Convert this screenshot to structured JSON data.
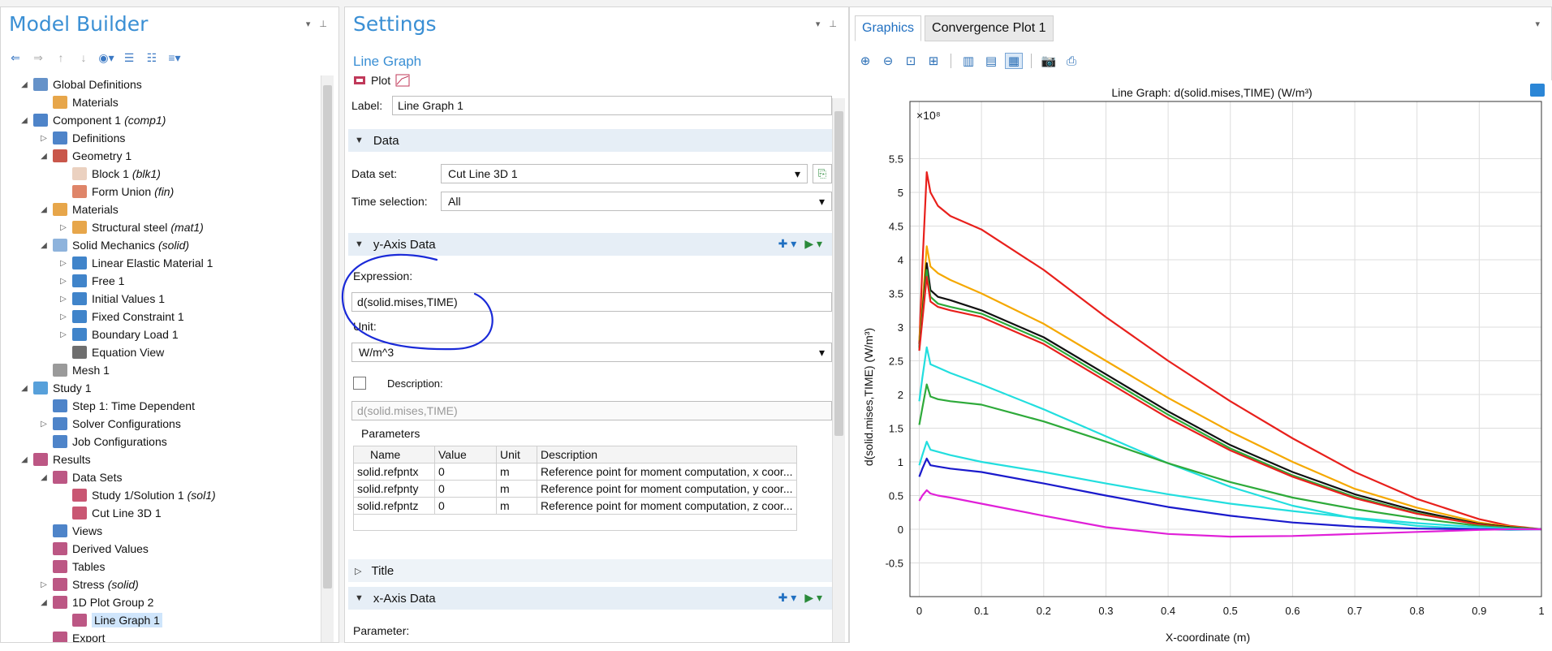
{
  "model_builder": {
    "title": "Model Builder",
    "tree": [
      {
        "label": "Global Definitions",
        "level": 1,
        "icon": "globe-icon",
        "expanded": true,
        "color": "#4a7fc0"
      },
      {
        "label": "Materials",
        "level": 2,
        "icon": "materials-icon",
        "color": "#e3962a"
      },
      {
        "label": "Component 1",
        "suffix": "(comp1)",
        "level": 1,
        "icon": "component-icon",
        "expanded": true,
        "color": "#2f6fbf"
      },
      {
        "label": "Definitions",
        "level": 2,
        "icon": "definitions-icon",
        "collapsed": true,
        "color": "#2f6fbf"
      },
      {
        "label": "Geometry 1",
        "level": 2,
        "icon": "geometry-icon",
        "expanded": true,
        "color": "#c0392b"
      },
      {
        "label": "Block 1",
        "suffix": "(blk1)",
        "level": 3,
        "icon": "block-icon",
        "color": "#e8c9b5"
      },
      {
        "label": "Form Union",
        "suffix": "(fin)",
        "level": 3,
        "icon": "form-union-icon",
        "color": "#d9704f"
      },
      {
        "label": "Materials",
        "level": 2,
        "icon": "materials-icon",
        "expanded": true,
        "color": "#e3962a"
      },
      {
        "label": "Structural steel",
        "suffix": "(mat1)",
        "level": 3,
        "icon": "material-icon",
        "collapsed": true,
        "color": "#e3962a"
      },
      {
        "label": "Solid Mechanics",
        "suffix": "(solid)",
        "level": 2,
        "icon": "solid-mechanics-icon",
        "expanded": true,
        "color": "#7aa6d6"
      },
      {
        "label": "Linear Elastic Material 1",
        "level": 3,
        "icon": "domain-icon",
        "collapsed": true,
        "color": "#1f6fc1"
      },
      {
        "label": "Free 1",
        "level": 3,
        "icon": "domain-icon",
        "collapsed": true,
        "color": "#1f6fc1"
      },
      {
        "label": "Initial Values 1",
        "level": 3,
        "icon": "domain-icon",
        "collapsed": true,
        "color": "#1f6fc1"
      },
      {
        "label": "Fixed Constraint 1",
        "level": 3,
        "icon": "boundary-icon",
        "collapsed": true,
        "color": "#1f6fc1"
      },
      {
        "label": "Boundary Load 1",
        "level": 3,
        "icon": "boundary-icon",
        "collapsed": true,
        "color": "#1f6fc1"
      },
      {
        "label": "Equation View",
        "level": 3,
        "icon": "equation-view-icon",
        "color": "#555555"
      },
      {
        "label": "Mesh 1",
        "level": 2,
        "icon": "mesh-icon",
        "color": "#888888"
      },
      {
        "label": "Study 1",
        "level": 1,
        "icon": "study-icon",
        "expanded": true,
        "color": "#3a8fd4"
      },
      {
        "label": "Step 1: Time Dependent",
        "level": 2,
        "icon": "time-dependent-icon",
        "color": "#2f6fbf"
      },
      {
        "label": "Solver Configurations",
        "level": 2,
        "icon": "solver-icon",
        "collapsed": true,
        "color": "#2f6fbf"
      },
      {
        "label": "Job Configurations",
        "level": 2,
        "icon": "job-icon",
        "color": "#2f6fbf"
      },
      {
        "label": "Results",
        "level": 1,
        "icon": "results-icon",
        "expanded": true,
        "color": "#b03a6f"
      },
      {
        "label": "Data Sets",
        "level": 2,
        "icon": "data-sets-icon",
        "expanded": true,
        "color": "#b03a6f"
      },
      {
        "label": "Study 1/Solution 1",
        "suffix": "(sol1)",
        "level": 3,
        "icon": "solution-icon",
        "color": "#c0395a"
      },
      {
        "label": "Cut Line 3D 1",
        "level": 3,
        "icon": "cut-line-icon",
        "color": "#c0395a"
      },
      {
        "label": "Views",
        "level": 2,
        "icon": "views-icon",
        "color": "#2f6fbf"
      },
      {
        "label": "Derived Values",
        "level": 2,
        "icon": "derived-values-icon",
        "color": "#b03a6f"
      },
      {
        "label": "Tables",
        "level": 2,
        "icon": "tables-icon",
        "color": "#b03a6f"
      },
      {
        "label": "Stress",
        "suffix": "(solid)",
        "level": 2,
        "icon": "plot-group-icon",
        "collapsed": true,
        "color": "#b03a6f"
      },
      {
        "label": "1D Plot Group 2",
        "level": 2,
        "icon": "plot-1d-icon",
        "expanded": true,
        "color": "#b03a6f"
      },
      {
        "label": "Line Graph 1",
        "level": 3,
        "icon": "line-graph-icon",
        "selected": true,
        "color": "#b03a6f"
      },
      {
        "label": "Export",
        "level": 2,
        "icon": "export-icon",
        "color": "#b03a6f"
      }
    ]
  },
  "settings": {
    "title": "Settings",
    "subtitle": "Line Graph",
    "plot_label": "Plot",
    "label_field": {
      "label": "Label:",
      "value": "Line Graph 1"
    },
    "data_section": "Data",
    "data_set": {
      "label": "Data set:",
      "value": "Cut Line 3D 1"
    },
    "time_selection": {
      "label": "Time selection:",
      "value": "All"
    },
    "y_axis_section": "y-Axis Data",
    "expression": {
      "label": "Expression:",
      "value": "d(solid.mises,TIME)"
    },
    "unit": {
      "label": "Unit:",
      "value": "W/m^3"
    },
    "description": {
      "label": "Description:",
      "value": "d(solid.mises,TIME)",
      "checked": false
    },
    "parameters": {
      "title": "Parameters",
      "columns": [
        "Name",
        "Value",
        "Unit",
        "Description"
      ],
      "rows": [
        [
          "solid.refpntx",
          "0",
          "m",
          "Reference point for moment computation, x coor..."
        ],
        [
          "solid.refpnty",
          "0",
          "m",
          "Reference point for moment computation, y coor..."
        ],
        [
          "solid.refpntz",
          "0",
          "m",
          "Reference point for moment computation, z coor..."
        ]
      ]
    },
    "title_section": "Title",
    "x_axis_section": "x-Axis Data",
    "parameter_label": "Parameter:"
  },
  "graphics": {
    "tabs": [
      "Graphics",
      "Convergence Plot 1"
    ],
    "active_tab": 0
  },
  "chart_data": {
    "type": "line",
    "title": "Line Graph: d(solid.mises,TIME)  (W/m³)",
    "xlabel": "X-coordinate (m)",
    "ylabel": "d(solid.mises,TIME)  (W/m³)",
    "y_multiplier": "×10⁸",
    "xlim": [
      -0.015,
      1.0
    ],
    "ylim": [
      -1.0,
      6.35
    ],
    "xticks": [
      0,
      0.1,
      0.2,
      0.3,
      0.4,
      0.5,
      0.6,
      0.7,
      0.8,
      0.9,
      1
    ],
    "xtick_labels": [
      "0",
      "0.1",
      "0.2",
      "0.3",
      "0.4",
      "0.5",
      "0.6",
      "0.7",
      "0.8",
      "0.9",
      "1"
    ],
    "yticks": [
      -0.5,
      0,
      0.5,
      1,
      1.5,
      2,
      2.5,
      3,
      3.5,
      4,
      4.5,
      5,
      5.5
    ],
    "ytick_labels": [
      "-0.5",
      "0",
      "0.5",
      "1",
      "1.5",
      "2",
      "2.5",
      "3",
      "3.5",
      "4",
      "4.5",
      "5",
      "5.5"
    ],
    "grid": true,
    "x": [
      0,
      0.005,
      0.012,
      0.018,
      0.03,
      0.05,
      0.1,
      0.2,
      0.3,
      0.4,
      0.5,
      0.6,
      0.7,
      0.8,
      0.9,
      0.95,
      1.0
    ],
    "series": [
      {
        "color": "#e8201c",
        "values": [
          2.75,
          3.9,
          5.3,
          5.0,
          4.8,
          4.65,
          4.45,
          3.85,
          3.15,
          2.5,
          1.9,
          1.35,
          0.85,
          0.45,
          0.15,
          0.05,
          0
        ]
      },
      {
        "color": "#f5a800",
        "values": [
          2.8,
          3.3,
          4.2,
          3.9,
          3.8,
          3.7,
          3.5,
          3.05,
          2.5,
          1.95,
          1.45,
          1.0,
          0.6,
          0.32,
          0.1,
          0.04,
          0
        ]
      },
      {
        "color": "#111111",
        "values": [
          2.7,
          3.2,
          3.95,
          3.55,
          3.45,
          3.4,
          3.25,
          2.85,
          2.3,
          1.75,
          1.25,
          0.85,
          0.52,
          0.27,
          0.08,
          0.03,
          0
        ]
      },
      {
        "color": "#2eaa3a",
        "values": [
          2.68,
          3.15,
          3.85,
          3.45,
          3.35,
          3.3,
          3.2,
          2.8,
          2.25,
          1.7,
          1.2,
          0.8,
          0.48,
          0.24,
          0.07,
          0.02,
          0
        ]
      },
      {
        "color": "#e8201c",
        "values": [
          2.65,
          3.1,
          3.75,
          3.38,
          3.3,
          3.25,
          3.15,
          2.75,
          2.2,
          1.65,
          1.17,
          0.78,
          0.46,
          0.23,
          0.07,
          0.02,
          0
        ]
      },
      {
        "color": "#22dede",
        "values": [
          1.9,
          2.25,
          2.7,
          2.45,
          2.4,
          2.32,
          2.15,
          1.78,
          1.38,
          0.98,
          0.63,
          0.35,
          0.16,
          0.05,
          0.0,
          -0.01,
          0
        ]
      },
      {
        "color": "#2eaa3a",
        "values": [
          1.55,
          1.8,
          2.15,
          1.97,
          1.93,
          1.9,
          1.85,
          1.6,
          1.3,
          0.98,
          0.7,
          0.47,
          0.3,
          0.16,
          0.05,
          0.02,
          0
        ]
      },
      {
        "color": "#22dede",
        "values": [
          0.95,
          1.1,
          1.3,
          1.18,
          1.15,
          1.1,
          1.0,
          0.85,
          0.68,
          0.52,
          0.38,
          0.27,
          0.17,
          0.09,
          0.03,
          0.01,
          0
        ]
      },
      {
        "color": "#1a1acc",
        "values": [
          0.78,
          0.9,
          1.05,
          0.95,
          0.93,
          0.9,
          0.85,
          0.68,
          0.5,
          0.33,
          0.2,
          0.1,
          0.04,
          0.01,
          0.0,
          0.0,
          0
        ]
      },
      {
        "color": "#e020d8",
        "values": [
          0.42,
          0.5,
          0.58,
          0.53,
          0.5,
          0.47,
          0.38,
          0.2,
          0.03,
          -0.07,
          -0.11,
          -0.1,
          -0.07,
          -0.04,
          -0.01,
          0.0,
          0
        ]
      }
    ]
  }
}
